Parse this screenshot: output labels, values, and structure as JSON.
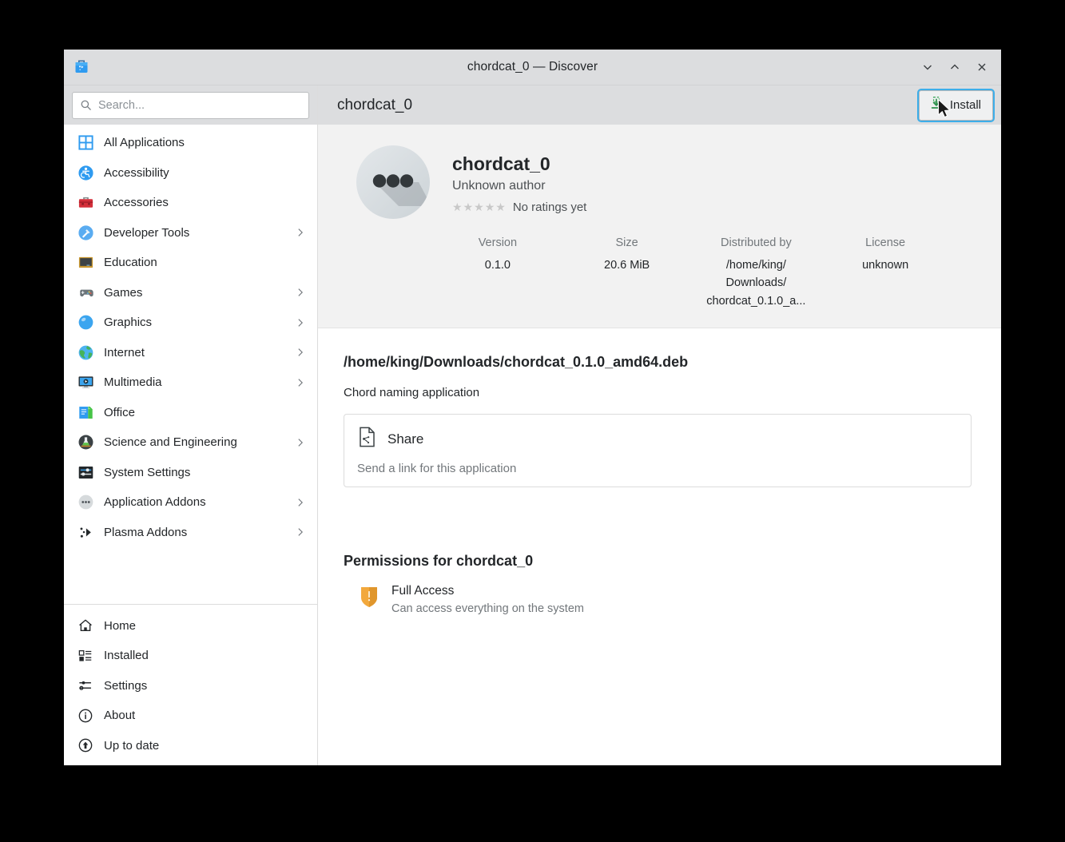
{
  "window": {
    "titlebar_title": "chordcat_0 — Discover",
    "app_icon": "discover-shopping-bag-icon",
    "buttons": {
      "minimize": "minimize-icon",
      "maximize": "maximize-icon",
      "close": "close-icon"
    }
  },
  "search": {
    "placeholder": "Search...",
    "value": "",
    "icon": "search-icon"
  },
  "sidebar": {
    "categories": [
      {
        "label": "All Applications",
        "icon": "grid-icon",
        "has_submenu": false
      },
      {
        "label": "Accessibility",
        "icon": "accessibility-icon",
        "has_submenu": false
      },
      {
        "label": "Accessories",
        "icon": "toolbox-icon",
        "has_submenu": false
      },
      {
        "label": "Developer Tools",
        "icon": "hammer-icon",
        "has_submenu": true
      },
      {
        "label": "Education",
        "icon": "blackboard-icon",
        "has_submenu": false
      },
      {
        "label": "Games",
        "icon": "gamepad-icon",
        "has_submenu": true
      },
      {
        "label": "Graphics",
        "icon": "sphere-icon",
        "has_submenu": true
      },
      {
        "label": "Internet",
        "icon": "globe-icon",
        "has_submenu": true
      },
      {
        "label": "Multimedia",
        "icon": "monitor-play-icon",
        "has_submenu": true
      },
      {
        "label": "Office",
        "icon": "document-icon",
        "has_submenu": false
      },
      {
        "label": "Science and Engineering",
        "icon": "flask-icon",
        "has_submenu": true
      },
      {
        "label": "System Settings",
        "icon": "sliders-icon",
        "has_submenu": false
      },
      {
        "label": "Application Addons",
        "icon": "dots-circle-icon",
        "has_submenu": true
      },
      {
        "label": "Plasma Addons",
        "icon": "plasma-icon",
        "has_submenu": true
      }
    ],
    "nav": [
      {
        "label": "Home",
        "icon": "home-icon"
      },
      {
        "label": "Installed",
        "icon": "installed-list-icon"
      },
      {
        "label": "Settings",
        "icon": "settings-sliders-icon"
      },
      {
        "label": "About",
        "icon": "info-circle-icon"
      },
      {
        "label": "Up to date",
        "icon": "up-to-date-icon"
      }
    ]
  },
  "main": {
    "page_title": "chordcat_0",
    "install_button": {
      "label": "Install",
      "icon": "download-icon"
    },
    "app": {
      "icon": "three-dots-app-icon",
      "name": "chordcat_0",
      "author": "Unknown author",
      "rating_text": "No ratings yet",
      "stars_total": 5,
      "stars_filled": 0
    },
    "metadata": [
      {
        "label": "Version",
        "value": "0.1.0"
      },
      {
        "label": "Size",
        "value": "20.6 MiB"
      },
      {
        "label": "Distributed by",
        "value": "/home/king/\nDownloads/\nchordcat_0.1.0_a..."
      },
      {
        "label": "License",
        "value": "unknown"
      }
    ],
    "package_path": "/home/king/Downloads/chordcat_0.1.0_amd64.deb",
    "description": "Chord naming application",
    "share": {
      "title": "Share",
      "subtitle": "Send a link for this application",
      "icon": "share-document-icon"
    },
    "permissions": {
      "heading": "Permissions for chordcat_0",
      "items": [
        {
          "name": "Full Access",
          "description": "Can access everything on the system",
          "icon": "shield-warning-icon"
        }
      ]
    }
  },
  "colors": {
    "accent": "#3daee9",
    "titlebar": "#dcdddf",
    "hero_bg": "#f2f2f2",
    "permission_shield": "#f5a623",
    "install_icon_green": "#27ae60"
  }
}
